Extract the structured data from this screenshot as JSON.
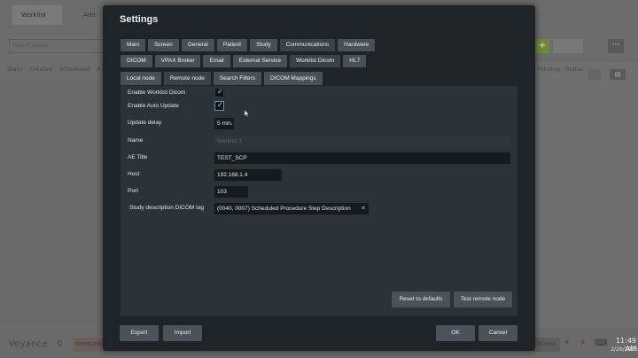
{
  "background": {
    "tabs": [
      "Worklist",
      "Add"
    ],
    "search_placeholder": "Patient Name",
    "columns_left": [
      "State",
      "Created",
      "Scheduled",
      "A"
    ],
    "columns_right": [
      "Pending",
      "Status"
    ],
    "logo": "Voyance",
    "emergency_label": "EMERGENCY",
    "donor_label": "DONOR",
    "time": "11:49 AM",
    "date": "2/26/2025"
  },
  "settings": {
    "title": "Settings",
    "main_tabs": [
      "Main",
      "Screen",
      "General",
      "Patient",
      "Study",
      "Communications",
      "Hardware"
    ],
    "comm_tabs": [
      "DICOM",
      "VPAX Broker",
      "Email",
      "External Service",
      "Worklist Dicom",
      "HL7"
    ],
    "sub_tabs": [
      "Local node",
      "Remote node",
      "Search Filters",
      "DICOM Mappings"
    ],
    "fields": {
      "enable_worklist_label": "Enable Worklist Dicom",
      "enable_worklist_checked": true,
      "enable_auto_update_label": "Enable Auto Update",
      "enable_auto_update_checked": true,
      "update_delay_label": "Update delay",
      "update_delay_value": "5",
      "update_delay_unit": "min.",
      "name_label": "Name",
      "name_value": "Worklist 1",
      "ae_title_label": "AE Title",
      "ae_title_value": "TEST_SCP",
      "host_label": "Host",
      "host_value": "192.168.1.4",
      "port_label": "Port",
      "port_value": "103",
      "study_desc_label": "Study description DICOM tag",
      "study_desc_value": "(0040, 0007) Scheduled Procedure Step Description"
    },
    "buttons": {
      "reset": "Reset to defaults",
      "test": "Test remote node",
      "export": "Export",
      "import": "Import",
      "ok": "OK",
      "cancel": "Cancel"
    }
  }
}
